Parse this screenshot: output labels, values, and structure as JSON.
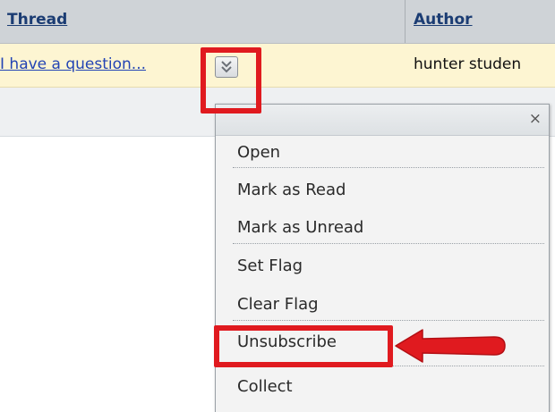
{
  "table": {
    "header": {
      "thread": "Thread",
      "author": "Author"
    },
    "row": {
      "thread_link": "I have a question...",
      "author": "hunter studen"
    }
  },
  "menu": {
    "close": "×",
    "items": [
      {
        "label": "Open"
      },
      {
        "label": "Mark as Read"
      },
      {
        "label": "Mark as Unread"
      },
      {
        "label": "Set Flag"
      },
      {
        "label": "Clear Flag"
      },
      {
        "label": "Unsubscribe"
      },
      {
        "label": "Collect"
      }
    ]
  },
  "icons": {
    "toggle": "chevron-double-down-icon",
    "annotation": "arrow-left-icon"
  },
  "colors": {
    "highlight": "#e01a1f",
    "link": "#2344b4",
    "row_highlight": "#fdf5d2",
    "header": "#cfd3d7"
  }
}
